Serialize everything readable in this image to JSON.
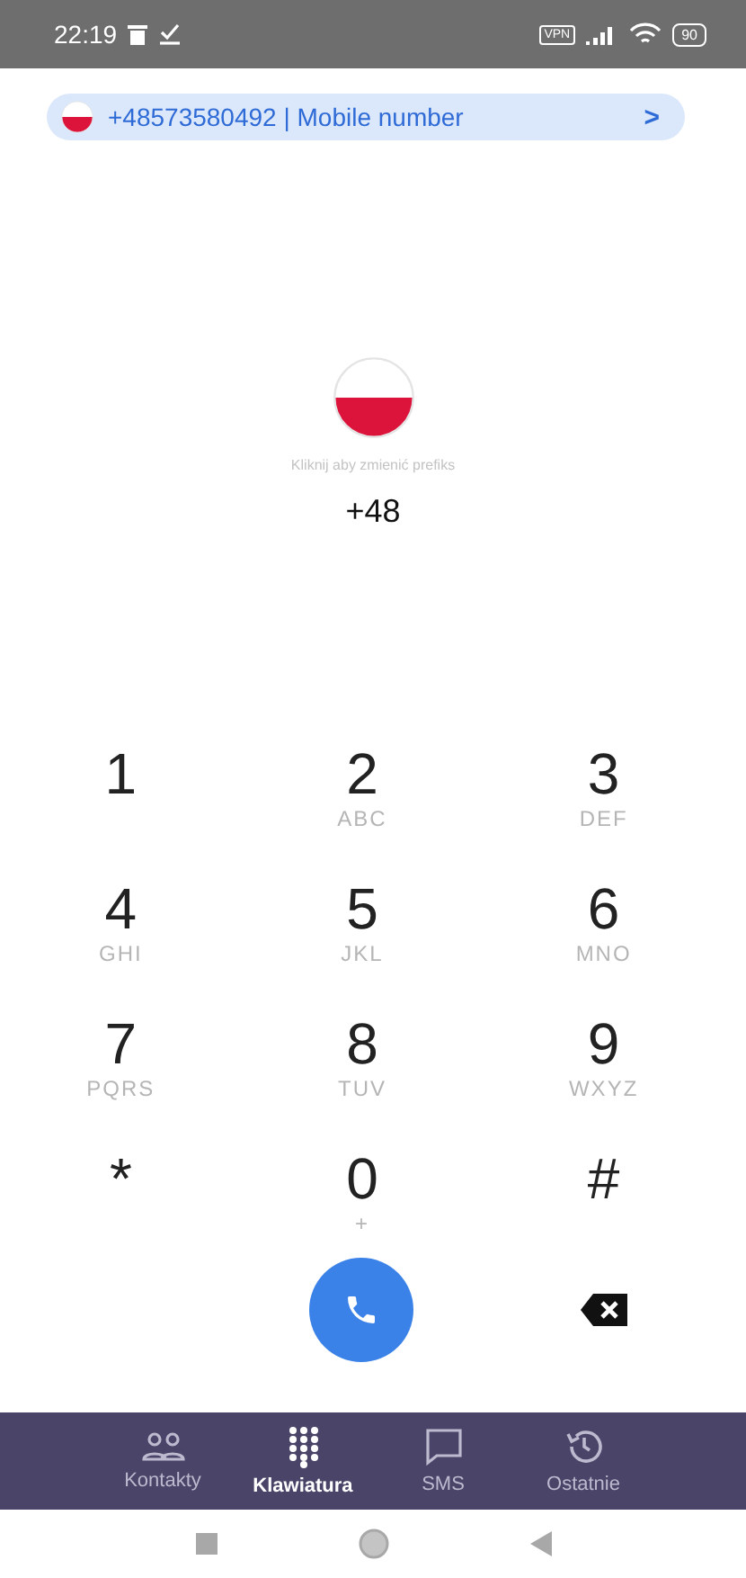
{
  "status_bar": {
    "time": "22:19",
    "vpn": "VPN",
    "battery": "90"
  },
  "number_banner": {
    "text": "+48573580492 | Mobile number",
    "chevron": ">"
  },
  "prefix": {
    "hint": "Kliknij aby zmienić prefiks",
    "code": "+48"
  },
  "keypad": [
    {
      "digit": "1"
    },
    {
      "digit": "2",
      "letters": "ABC"
    },
    {
      "digit": "3",
      "letters": "DEF"
    },
    {
      "digit": "4",
      "letters": "GHI"
    },
    {
      "digit": "5",
      "letters": "JKL"
    },
    {
      "digit": "6",
      "letters": "MNO"
    },
    {
      "digit": "7",
      "letters": "PQRS"
    },
    {
      "digit": "8",
      "letters": "TUV"
    },
    {
      "digit": "9",
      "letters": "WXYZ"
    },
    {
      "digit": "*"
    },
    {
      "digit": "0",
      "letters": "+"
    },
    {
      "digit": "#"
    }
  ],
  "bottom_nav": [
    {
      "label": "Kontakty",
      "kind": "contacts",
      "selected": false
    },
    {
      "label": "Klawiatura",
      "kind": "dialpad",
      "selected": true
    },
    {
      "label": "SMS",
      "kind": "sms",
      "selected": false
    },
    {
      "label": "Ostatnie",
      "kind": "recent",
      "selected": false
    }
  ]
}
